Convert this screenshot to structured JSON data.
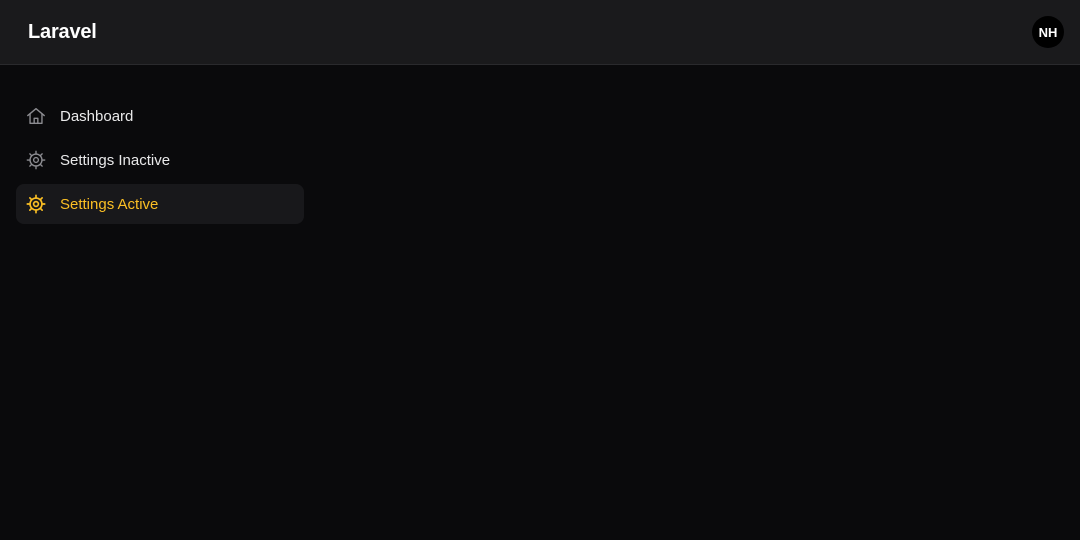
{
  "header": {
    "brand": "Laravel",
    "avatar_initials": "NH"
  },
  "sidebar": {
    "items": [
      {
        "label": "Dashboard",
        "icon": "home-icon",
        "active": false
      },
      {
        "label": "Settings Inactive",
        "icon": "gear-icon",
        "active": false
      },
      {
        "label": "Settings Active",
        "icon": "gear-icon",
        "active": true
      }
    ]
  },
  "colors": {
    "background": "#0a0a0c",
    "topbar": "#1a1a1c",
    "accent": "#fbbf24",
    "text": "#e9e9ea",
    "icon_inactive": "#8c8c91"
  }
}
